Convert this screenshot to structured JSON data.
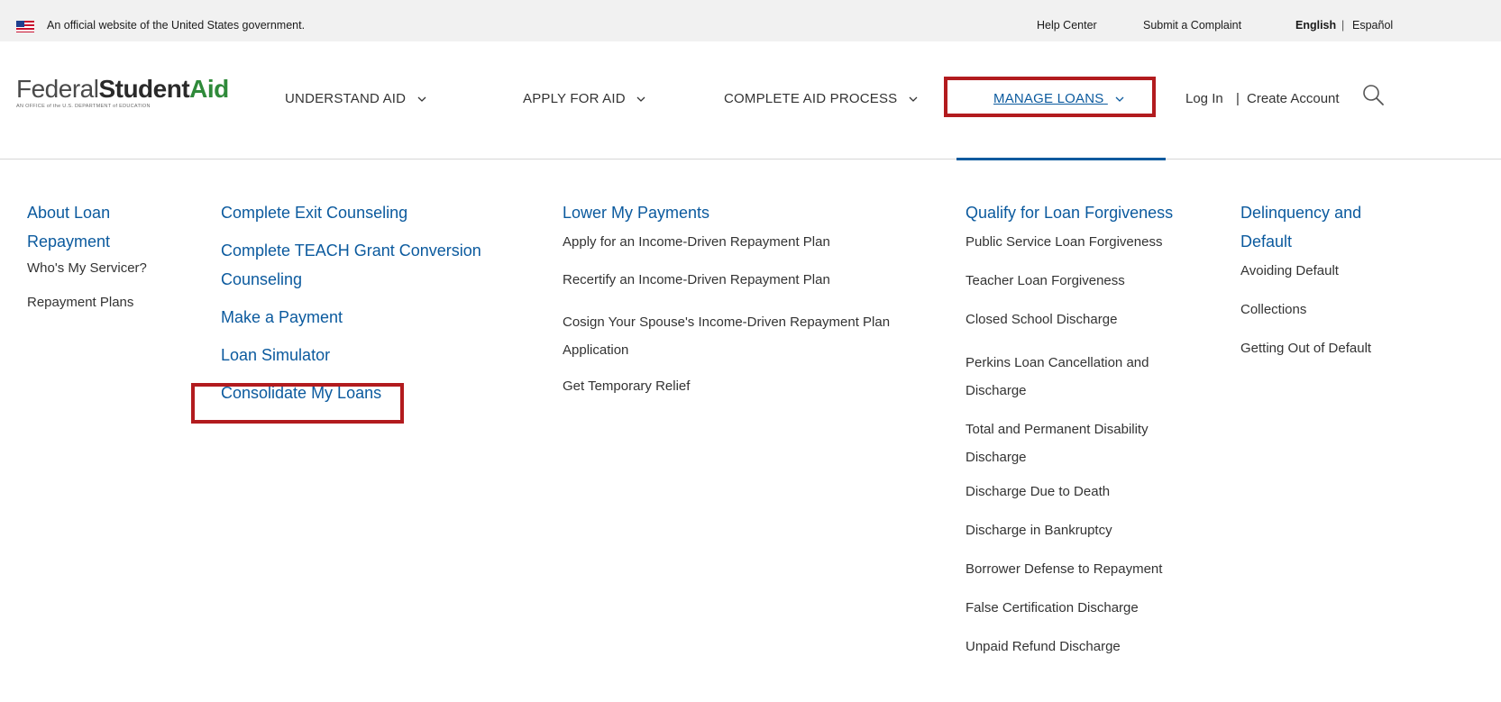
{
  "gov_banner": {
    "text": "An official website of the United States government.",
    "help_center": "Help Center",
    "submit_complaint": "Submit a Complaint",
    "english": "English",
    "separator": "|",
    "espanol": "Español"
  },
  "logo": {
    "part1": "Federal",
    "part2": "Student",
    "part3": "Aid",
    "subtitle": "AN OFFICE of the U.S. DEPARTMENT of EDUCATION"
  },
  "nav": {
    "understand": "UNDERSTAND AID",
    "apply": "APPLY FOR AID",
    "complete": "COMPLETE AID PROCESS",
    "manage": "MANAGE LOANS",
    "login": "Log In",
    "separator": "|",
    "create": "Create Account"
  },
  "menu": {
    "col1": {
      "heading": "About Loan Repayment",
      "items": [
        "Who's My Servicer?",
        "Repayment Plans"
      ]
    },
    "col2": {
      "items": [
        "Complete Exit Counseling",
        "Complete TEACH Grant Conversion Counseling",
        "Make a Payment",
        "Loan Simulator",
        "Consolidate My Loans"
      ]
    },
    "col3": {
      "heading": "Lower My Payments",
      "items": [
        "Apply for an Income-Driven Repayment Plan",
        "Recertify an Income-Driven Repayment Plan",
        "Cosign Your Spouse's Income-Driven Repayment Plan Application",
        "Get Temporary Relief"
      ]
    },
    "col4": {
      "heading": "Qualify for Loan Forgiveness",
      "items": [
        "Public Service Loan Forgiveness",
        "Teacher Loan Forgiveness",
        "Closed School Discharge",
        "Perkins Loan Cancellation and Discharge",
        "Total and Permanent Disability Discharge",
        "Discharge Due to Death",
        "Discharge in Bankruptcy",
        "Borrower Defense to Repayment",
        "False Certification Discharge",
        "Unpaid Refund Discharge"
      ]
    },
    "col5": {
      "heading": "Delinquency and Default",
      "items": [
        "Avoiding Default",
        "Collections",
        "Getting Out of Default"
      ]
    }
  },
  "colors": {
    "link_blue": "#0b5a9e",
    "highlight_red": "#b21b1e",
    "logo_green": "#2f8a3a"
  },
  "icons": [
    "us-flag-icon",
    "chevron-down-icon",
    "search-icon"
  ]
}
